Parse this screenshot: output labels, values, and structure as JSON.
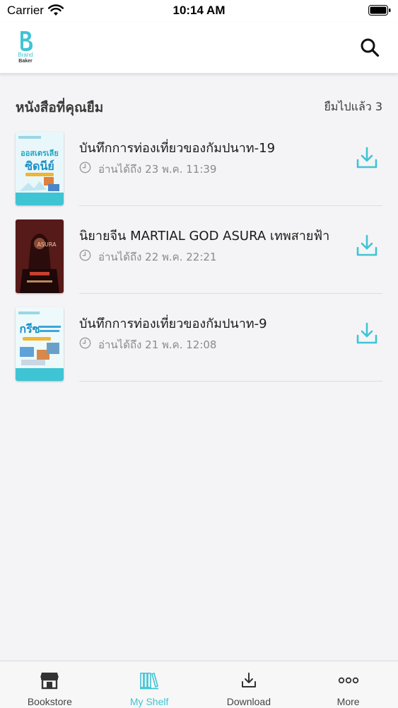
{
  "status_bar": {
    "carrier": "Carrier",
    "time": "10:14 AM"
  },
  "header": {
    "brand_line1": "Brand",
    "brand_line2": "Baker",
    "logo_icon": "brand-b-logo",
    "search_icon": "search-icon"
  },
  "section": {
    "title": "หนังสือที่คุณยืม",
    "count_text": "ยืมไปแล้ว 3"
  },
  "books": [
    {
      "title": "บันทึกการท่องเที่ยวของกัมปนาท-19",
      "due": "อ่านได้ถึง 23 พ.ค. 11:39"
    },
    {
      "title": "นิยายจีน MARTIAL GOD ASURA เทพสายฟ้า",
      "due": "อ่านได้ถึง 22 พ.ค. 22:21"
    },
    {
      "title": "บันทึกการท่องเที่ยวของกัมปนาท-9",
      "due": "อ่านได้ถึง 21 พ.ค. 12:08"
    }
  ],
  "tabs": [
    {
      "label": "Bookstore",
      "icon": "store-icon"
    },
    {
      "label": "My Shelf",
      "icon": "bookshelf-icon",
      "active": true
    },
    {
      "label": "Download",
      "icon": "download-icon"
    },
    {
      "label": "More",
      "icon": "more-dots-icon"
    }
  ],
  "colors": {
    "accent": "#3fc4d4",
    "text": "#1a1a1a",
    "muted": "#8a8a8a",
    "background": "#f4f4f6"
  }
}
